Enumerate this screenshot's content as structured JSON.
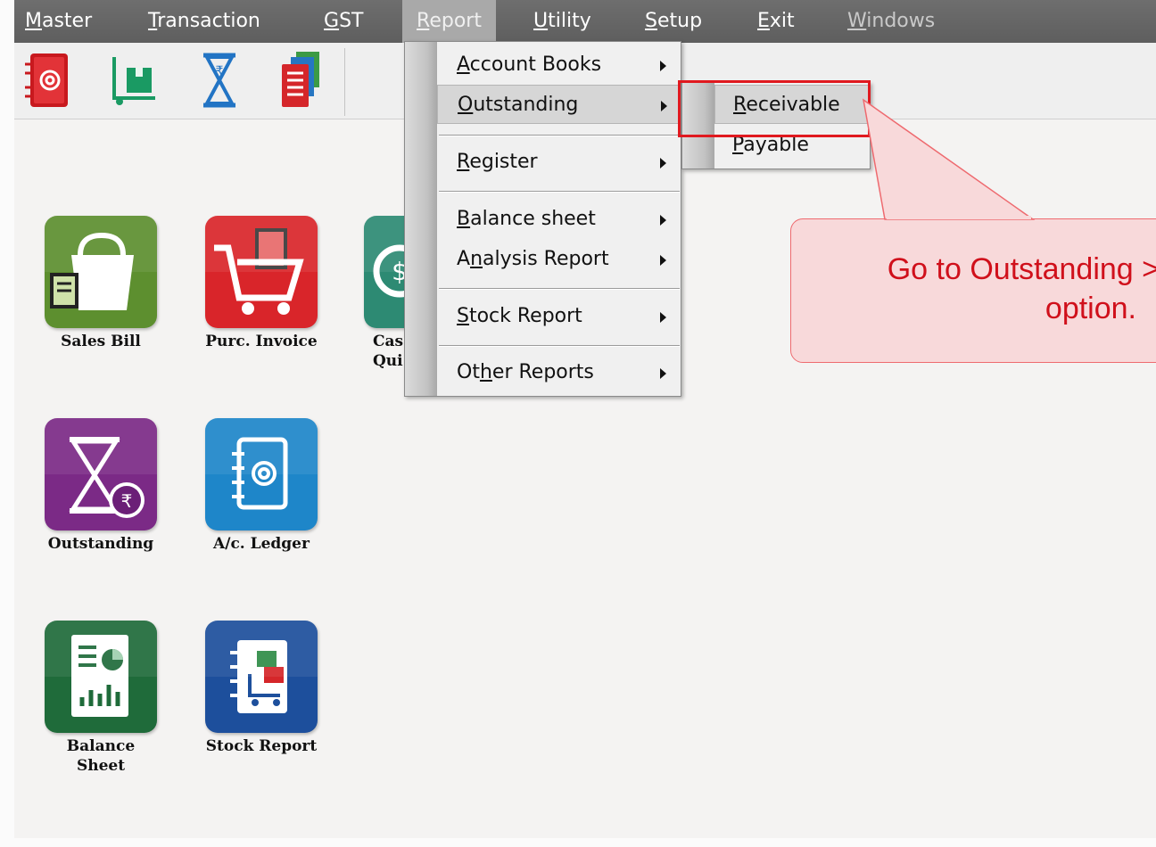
{
  "menubar": {
    "items": [
      {
        "label": "Master",
        "u": "M",
        "rest": "aster",
        "disabled": false
      },
      {
        "label": "Transaction",
        "u": "T",
        "rest": "ransaction",
        "disabled": false
      },
      {
        "label": "GST",
        "u": "G",
        "rest": "ST",
        "disabled": false
      },
      {
        "label": "Report",
        "u": "R",
        "rest": "eport",
        "disabled": false
      },
      {
        "label": "Utility",
        "u": "U",
        "rest": "tility",
        "disabled": false
      },
      {
        "label": "Setup",
        "u": "S",
        "rest": "etup",
        "disabled": false
      },
      {
        "label": "Exit",
        "u": "E",
        "rest": "xit",
        "disabled": false
      },
      {
        "label": "Windows",
        "u": "W",
        "rest": "indows",
        "disabled": true
      }
    ]
  },
  "toolbar": {
    "icons": [
      "ledger-book-icon",
      "stock-trolley-icon",
      "hourglass-rupee-icon",
      "report-stack-icon"
    ]
  },
  "desktop": {
    "tiles": [
      {
        "name": "sales-bill-tile",
        "label": "Sales Bill",
        "color": "#5d8f2f",
        "icon": "shopping-bag-icon"
      },
      {
        "name": "purc-invoice-tile",
        "label": "Purc. Invoice",
        "color": "#d9252a",
        "icon": "cart-icon"
      },
      {
        "name": "cash-quick-tile",
        "label": "Cas\nQui",
        "color": "#2d8a73",
        "icon": "cash-icon"
      },
      {
        "name": "outstanding-tile",
        "label": "Outstanding",
        "color": "#7b2a86",
        "icon": "hourglass-rupee-icon"
      },
      {
        "name": "ac-ledger-tile",
        "label": "A/c. Ledger",
        "color": "#1e86c9",
        "icon": "ledger-book-icon"
      },
      {
        "name": "balance-sheet-tile",
        "label": "Balance\nSheet",
        "color": "#1f6b3a",
        "icon": "report-chart-icon"
      },
      {
        "name": "stock-report-tile",
        "label": "Stock Report",
        "color": "#1d4f9c",
        "icon": "stock-trolley-icon"
      }
    ]
  },
  "report_menu": {
    "items": [
      {
        "label": "Account Books",
        "pre": "",
        "u": "A",
        "rest": "ccount Books"
      },
      {
        "label": "Outstanding",
        "pre": "",
        "u": "O",
        "rest": "utstanding"
      },
      {
        "label": "Register",
        "pre": "",
        "u": "R",
        "rest": "egister"
      },
      {
        "label": "Balance sheet",
        "pre": "",
        "u": "B",
        "rest": "alance sheet"
      },
      {
        "label": "Analysis Report",
        "pre": "A",
        "u": "n",
        "rest": "alysis Report"
      },
      {
        "label": "Stock Report",
        "pre": "",
        "u": "S",
        "rest": "tock Report"
      },
      {
        "label": "Other Reports",
        "pre": "Ot",
        "u": "h",
        "rest": "er Reports"
      }
    ]
  },
  "outstanding_submenu": {
    "items": [
      {
        "label": "Receivable",
        "u": "R",
        "rest": "eceivable"
      },
      {
        "label": "Payable",
        "u": "P",
        "rest": "ayable"
      }
    ]
  },
  "callout": {
    "line1": "Go to Outstanding >",
    "line2": "option."
  },
  "colors": {
    "highlight_box": "#e0191f",
    "callout_text": "#d0101b",
    "callout_fill": "#f8d9da"
  }
}
